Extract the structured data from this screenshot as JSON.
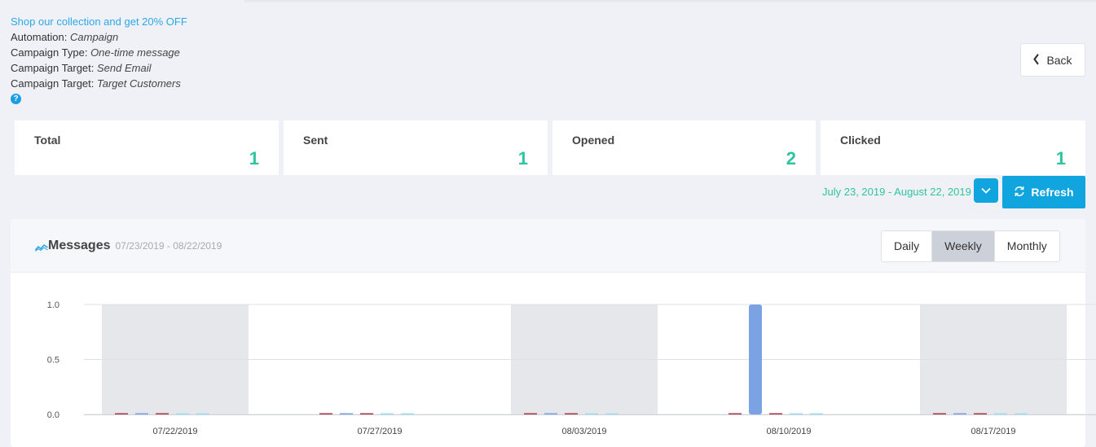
{
  "info": {
    "promo_link": "Shop our collection and get 20% OFF",
    "rows": [
      {
        "label": "Automation:",
        "value": "Campaign"
      },
      {
        "label": "Campaign Type:",
        "value": "One-time message"
      },
      {
        "label": "Campaign Target:",
        "value": "Send Email"
      },
      {
        "label": "Campaign Target:",
        "value": "Target Customers"
      }
    ],
    "help_glyph": "?"
  },
  "back_button": {
    "label": "Back",
    "icon": "chevron-left-icon"
  },
  "stats": [
    {
      "label": "Total",
      "value": "1"
    },
    {
      "label": "Sent",
      "value": "1"
    },
    {
      "label": "Opened",
      "value": "2"
    },
    {
      "label": "Clicked",
      "value": "1"
    }
  ],
  "date_range": "July 23, 2019 - August 22, 2019",
  "refresh_button": {
    "label": "Refresh",
    "icon": "refresh-icon"
  },
  "panel": {
    "title": "Messages",
    "subtitle": "07/23/2019 - 08/22/2019",
    "icon": "line-chart-icon",
    "tabs": [
      "Daily",
      "Weekly",
      "Monthly"
    ],
    "active_tab": "Weekly"
  },
  "colors": {
    "accent": "#10a5df",
    "stat_value": "#2ec4a0",
    "bar_blue": "#7ba3e3",
    "bar_red": "#b0354a",
    "bar_cyan": "#9fe3f0"
  },
  "chart_data": {
    "type": "bar",
    "categories": [
      "07/22/2019",
      "07/27/2019",
      "08/03/2019",
      "08/10/2019",
      "08/17/2019"
    ],
    "series": [
      {
        "values": [
          0,
          0,
          0,
          0,
          0
        ],
        "color": "#b0354a"
      },
      {
        "values": [
          0,
          0,
          0,
          1,
          0
        ],
        "color": "#7ba3e3"
      },
      {
        "values": [
          0,
          0,
          0,
          0,
          0
        ],
        "color": "#b0354a"
      },
      {
        "values": [
          0,
          0,
          0,
          0,
          0
        ],
        "color": "#9fe3f0"
      },
      {
        "values": [
          0,
          0,
          0,
          0,
          0
        ],
        "color": "#9fe3f0"
      }
    ],
    "yticks": [
      "0.0",
      "0.5",
      "1.0"
    ],
    "ylim": [
      0,
      1
    ],
    "grid": true,
    "shaded_bands": [
      0,
      2,
      4
    ]
  }
}
